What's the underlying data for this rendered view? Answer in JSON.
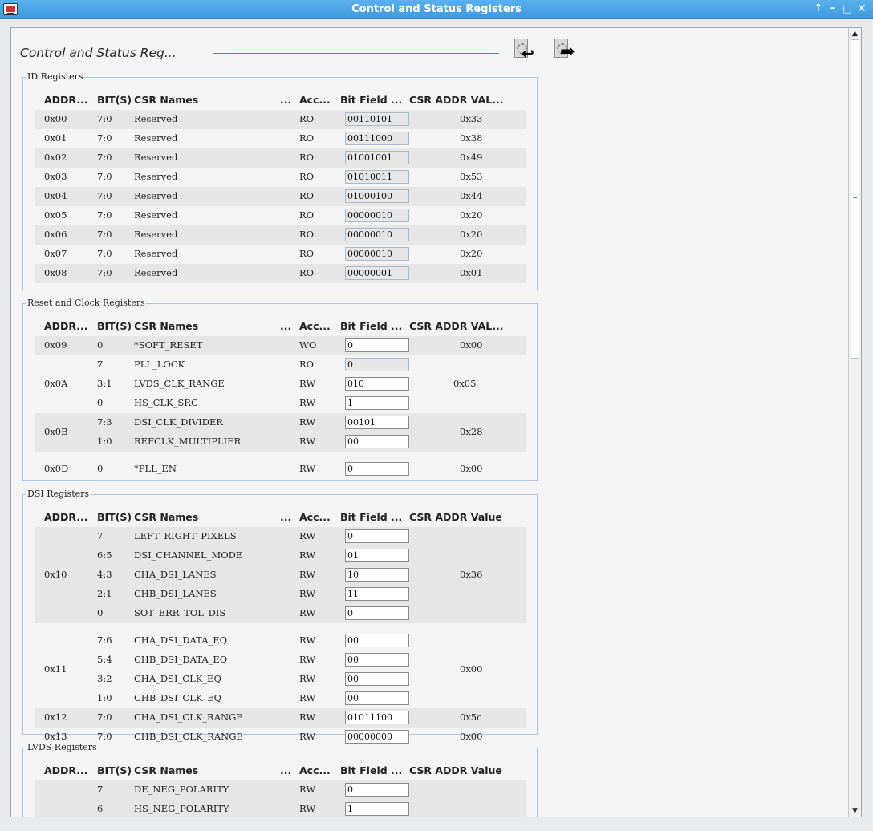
{
  "window": {
    "title": "Control and Status Registers"
  },
  "page_title": "Control and Status Reg...",
  "columns": {
    "addr": "ADDR...",
    "bits": "BIT(S)",
    "name": "CSR Names",
    "more": "...",
    "access": "Acc...",
    "bitfield": "Bit Field ...",
    "addr_value": "CSR ADDR VAL...",
    "addr_value_full": "CSR ADDR Value"
  },
  "groups": [
    {
      "label": "ID Registers",
      "value_header": "CSR ADDR VAL...",
      "rows": [
        {
          "addr": "0x00",
          "bits": "7:0",
          "name": "Reserved",
          "access": "RO",
          "field": "00110101",
          "value": "0x33"
        },
        {
          "addr": "0x01",
          "bits": "7:0",
          "name": "Reserved",
          "access": "RO",
          "field": "00111000",
          "value": "0x38"
        },
        {
          "addr": "0x02",
          "bits": "7:0",
          "name": "Reserved",
          "access": "RO",
          "field": "01001001",
          "value": "0x49"
        },
        {
          "addr": "0x03",
          "bits": "7:0",
          "name": "Reserved",
          "access": "RO",
          "field": "01010011",
          "value": "0x53"
        },
        {
          "addr": "0x04",
          "bits": "7:0",
          "name": "Reserved",
          "access": "RO",
          "field": "01000100",
          "value": "0x44"
        },
        {
          "addr": "0x05",
          "bits": "7:0",
          "name": "Reserved",
          "access": "RO",
          "field": "00000010",
          "value": "0x20"
        },
        {
          "addr": "0x06",
          "bits": "7:0",
          "name": "Reserved",
          "access": "RO",
          "field": "00000010",
          "value": "0x20"
        },
        {
          "addr": "0x07",
          "bits": "7:0",
          "name": "Reserved",
          "access": "RO",
          "field": "00000010",
          "value": "0x20"
        },
        {
          "addr": "0x08",
          "bits": "7:0",
          "name": "Reserved",
          "access": "RO",
          "field": "00000001",
          "value": "0x01"
        }
      ]
    },
    {
      "label": "Reset and Clock Registers",
      "value_header": "CSR ADDR VAL...",
      "registers": [
        {
          "addr": "0x09",
          "value": "0x00",
          "fields": [
            {
              "bits": "0",
              "name": "*SOFT_RESET",
              "access": "WO",
              "field": "0"
            }
          ]
        },
        {
          "addr": "0x0A",
          "value": "0x05",
          "fields": [
            {
              "bits": "7",
              "name": "PLL_LOCK",
              "access": "RO",
              "field": "0"
            },
            {
              "bits": "3:1",
              "name": "LVDS_CLK_RANGE",
              "access": "RW",
              "field": "010"
            },
            {
              "bits": "0",
              "name": "HS_CLK_SRC",
              "access": "RW",
              "field": "1"
            }
          ]
        },
        {
          "addr": "0x0B",
          "value": "0x28",
          "fields": [
            {
              "bits": "7:3",
              "name": "DSI_CLK_DIVIDER",
              "access": "RW",
              "field": "00101"
            },
            {
              "bits": "1:0",
              "name": "REFCLK_MULTIPLIER",
              "access": "RW",
              "field": "00"
            }
          ]
        },
        {
          "addr": "0x0D",
          "value": "0x00",
          "fields": [
            {
              "bits": "0",
              "name": "*PLL_EN",
              "access": "RW",
              "field": "0"
            }
          ]
        }
      ]
    },
    {
      "label": "DSI Registers",
      "value_header": "CSR ADDR Value",
      "registers": [
        {
          "addr": "0x10",
          "value": "0x36",
          "fields": [
            {
              "bits": "7",
              "name": "LEFT_RIGHT_PIXELS",
              "access": "RW",
              "field": "0"
            },
            {
              "bits": "6:5",
              "name": "DSI_CHANNEL_MODE",
              "access": "RW",
              "field": "01"
            },
            {
              "bits": "4:3",
              "name": "CHA_DSI_LANES",
              "access": "RW",
              "field": "10"
            },
            {
              "bits": "2:1",
              "name": "CHB_DSI_LANES",
              "access": "RW",
              "field": "11"
            },
            {
              "bits": "0",
              "name": "SOT_ERR_TOL_DIS",
              "access": "RW",
              "field": "0"
            }
          ]
        },
        {
          "addr": "0x11",
          "value": "0x00",
          "fields": [
            {
              "bits": "7:6",
              "name": "CHA_DSI_DATA_EQ",
              "access": "RW",
              "field": "00"
            },
            {
              "bits": "5:4",
              "name": "CHB_DSI_DATA_EQ",
              "access": "RW",
              "field": "00"
            },
            {
              "bits": "3:2",
              "name": "CHA_DSI_CLK_EQ",
              "access": "RW",
              "field": "00"
            },
            {
              "bits": "1:0",
              "name": "CHB_DSI_CLK_EQ",
              "access": "RW",
              "field": "00"
            }
          ]
        },
        {
          "addr": "0x12",
          "value": "0x5c",
          "fields": [
            {
              "bits": "7:0",
              "name": "CHA_DSI_CLK_RANGE",
              "access": "RW",
              "field": "01011100"
            }
          ]
        },
        {
          "addr": "0x13",
          "value": "0x00",
          "fields": [
            {
              "bits": "7:0",
              "name": "CHB_DSI_CLK_RANGE",
              "access": "RW",
              "field": "00000000"
            }
          ]
        }
      ]
    },
    {
      "label": "LVDS Registers",
      "value_header": "CSR ADDR Value",
      "registers": [
        {
          "addr": "",
          "value": "",
          "fields": [
            {
              "bits": "7",
              "name": "DE_NEG_POLARITY",
              "access": "RW",
              "field": "0"
            },
            {
              "bits": "6",
              "name": "HS_NEG_POLARITY",
              "access": "RW",
              "field": "1"
            }
          ]
        }
      ]
    }
  ],
  "icons": {
    "read_button": "read-registers-icon",
    "write_button": "write-registers-icon"
  },
  "colors": {
    "titlebar": "#3f9ae0",
    "group_border": "#a9c6dc",
    "row_band": "#e6e6e6"
  }
}
